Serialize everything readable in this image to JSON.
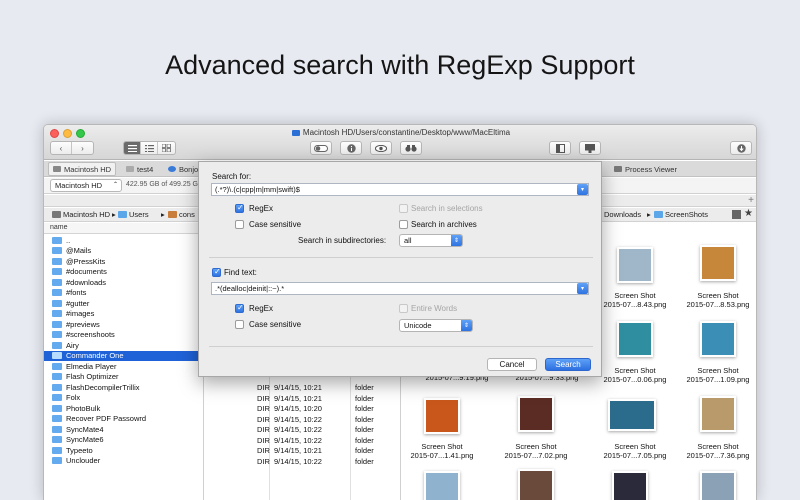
{
  "headline": "Advanced search with RegExp Support",
  "window": {
    "title": "Macintosh HD/Users/constantine/Desktop/www/MacEltima",
    "toolbar": {
      "back": "‹",
      "forward": "›",
      "view_icons": [
        "list-view-icon",
        "detail-view-icon",
        "grid-view-icon"
      ],
      "center_icons": [
        "toggle-icon",
        "info-icon",
        "eye-icon",
        "binoculars-icon"
      ],
      "right_icons": [
        "split-pane-icon",
        "monitor-icon"
      ],
      "download_icon": "download-icon"
    }
  },
  "tabs": {
    "left": [
      {
        "label": "Macintosh HD",
        "active": true
      },
      {
        "label": "test4",
        "active": false
      },
      {
        "label": "Bonjou",
        "active": false
      }
    ],
    "right": {
      "label": "Process Viewer"
    }
  },
  "drive": {
    "selected": "Macintosh HD",
    "info": "422.95 GB of 499.25 G"
  },
  "path": {
    "left": [
      "Macintosh HD",
      "Users",
      "cons"
    ],
    "right": [
      "Downloads",
      "ScreenShots"
    ]
  },
  "left_pane": {
    "column_header": "name",
    "items": [
      {
        "name": "..",
        "selected": false
      },
      {
        "name": "@Mails",
        "selected": false
      },
      {
        "name": "@PressKits",
        "selected": false
      },
      {
        "name": "#documents",
        "selected": false
      },
      {
        "name": "#downloads",
        "selected": false
      },
      {
        "name": "#fonts",
        "selected": false
      },
      {
        "name": "#gutter",
        "selected": false
      },
      {
        "name": "#images",
        "selected": false
      },
      {
        "name": "#previews",
        "selected": false
      },
      {
        "name": "#screenshoots",
        "selected": false
      },
      {
        "name": "Airy",
        "selected": false
      },
      {
        "name": "Commander One",
        "selected": true
      },
      {
        "name": "Elmedia Player",
        "selected": false
      },
      {
        "name": "Flash Optimizer",
        "selected": false
      },
      {
        "name": "FlashDecompilerTrillix",
        "selected": false
      },
      {
        "name": "Folx",
        "selected": false
      },
      {
        "name": "PhotoBulk",
        "selected": false
      },
      {
        "name": "Recover PDF Passowrd",
        "selected": false
      },
      {
        "name": "SyncMate4",
        "selected": false
      },
      {
        "name": "SyncMate6",
        "selected": false
      },
      {
        "name": "Typeeto",
        "selected": false
      },
      {
        "name": "Unclouder",
        "selected": false
      }
    ]
  },
  "mid_pane": {
    "rows": [
      {
        "size": "DIR",
        "date": "9/14/15, 10:21",
        "kind": "folder"
      },
      {
        "size": "DIR",
        "date": "9/14/15, 10:21",
        "kind": "folder"
      },
      {
        "size": "DIR",
        "date": "9/14/15, 10:20",
        "kind": "folder"
      },
      {
        "size": "DIR",
        "date": "9/14/15, 10:22",
        "kind": "folder"
      },
      {
        "size": "DIR",
        "date": "9/14/15, 10:22",
        "kind": "folder"
      },
      {
        "size": "DIR",
        "date": "9/14/15, 10:22",
        "kind": "folder"
      },
      {
        "size": "DIR",
        "date": "9/14/15, 10:21",
        "kind": "folder"
      },
      {
        "size": "DIR",
        "date": "9/14/15, 10:22",
        "kind": "folder"
      }
    ]
  },
  "right_pane": {
    "thumbs": [
      {
        "caption1": "Screen Shot",
        "caption2": "2015-07...8.43.png",
        "color": "#9fb7c9"
      },
      {
        "caption1": "Screen Shot",
        "caption2": "2015-07...8.53.png",
        "color": "#c6873a"
      },
      {
        "caption1": "",
        "caption2": "2015-07...9.19.png",
        "color": "#7a7a6a"
      },
      {
        "caption1": "",
        "caption2": "2015-07...9.33.png",
        "color": "#3d5566"
      },
      {
        "caption1": "Screen Shot",
        "caption2": "2015-07...0.06.png",
        "color": "#2f8fa0"
      },
      {
        "caption1": "Screen Shot",
        "caption2": "2015-07...1.09.png",
        "color": "#3b8fb6"
      },
      {
        "caption1": "",
        "caption2": "",
        "color": "#d08034"
      },
      {
        "caption1": "",
        "caption2": "",
        "color": "#4a2a2a"
      },
      {
        "caption1": "Screen Shot",
        "caption2": "2015-07...1.41.png",
        "color": "#c9571c"
      },
      {
        "caption1": "Screen Shot",
        "caption2": "2015-07...7.02.png",
        "color": "#5b2c24"
      },
      {
        "caption1": "Screen Shot",
        "caption2": "2015-07...7.05.png",
        "color": "#2b6c8d"
      },
      {
        "caption1": "Screen Shot",
        "caption2": "2015-07...7.36.png",
        "color": "#b99a6a"
      },
      {
        "caption1": "",
        "caption2": "",
        "color": "#8fb3cf"
      },
      {
        "caption1": "",
        "caption2": "",
        "color": "#6a4a3a"
      },
      {
        "caption1": "",
        "caption2": "",
        "color": "#2a2a3a"
      },
      {
        "caption1": "",
        "caption2": "",
        "color": "#8aa1b6"
      }
    ]
  },
  "dialog": {
    "search_for_label": "Search for:",
    "search_for_value": "(.*?)\\.(c|cpp|m|mm|swift)$",
    "regex1_label": "RegEx",
    "case1_label": "Case sensitive",
    "in_selections_label": "Search in selections",
    "in_archives_label": "Search in archives",
    "subdir_label": "Search in subdirectories:",
    "subdir_value": "all",
    "find_text_label": "Find text:",
    "find_text_value": ".*(dealloc|deinit|::~).*",
    "regex2_label": "RegEx",
    "entire_words_label": "Entire Words",
    "case2_label": "Case sensitive",
    "encoding_value": "Unicode",
    "cancel_label": "Cancel",
    "search_label": "Search"
  }
}
